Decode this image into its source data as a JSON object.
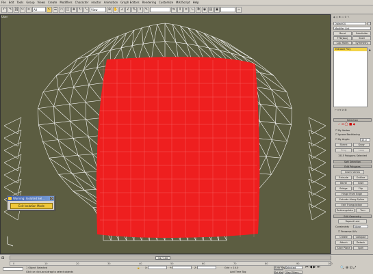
{
  "menu": [
    "File",
    "Edit",
    "Tools",
    "Group",
    "Views",
    "Create",
    "Modifiers",
    "Character",
    "reactor",
    "Animation",
    "Graph Editors",
    "Rendering",
    "Customize",
    "MAXScript",
    "Help"
  ],
  "toolbar": {
    "filter": "All",
    "ref_coord": "View",
    "named_set": ""
  },
  "viewport": {
    "label": "User"
  },
  "panel": {
    "object_name": "Object04",
    "modifier_list": "Modifier List",
    "buttons_row1": [
      "Bend",
      "Subdivide"
    ],
    "buttons_row2": [
      "FFD(box)",
      "Shell"
    ],
    "buttons_row3": [
      "Cap Holes",
      "Symmetry"
    ],
    "stack_item": "Editable Poly",
    "selection_title": "Selection",
    "by_vertex": "By Vertex",
    "ignore_backfacing": "Ignore Backfacing",
    "by_angle": "By Angle:",
    "by_angle_value": "45.0",
    "shrink": "Shrink",
    "grow": "Grow",
    "ring": "Ring",
    "loop": "Loop",
    "selected_info": "1515 Polygons Selected",
    "soft_selection": "Soft Selection",
    "edit_polygons": "Edit Polygons",
    "insert_vertex": "Insert Vertex",
    "extrude": "Extrude",
    "outline": "Outline",
    "bevel": "Bevel",
    "inset": "Inset",
    "bridge": "Bridge",
    "flip": "Flip",
    "hinge": "Hinge From Edge",
    "extrude_spline": "Extrude Along Spline",
    "edit_triangulation": "Edit Triangulation",
    "retriangulate": "Retriangulate",
    "turn": "Turn",
    "edit_geometry": "Edit Geometry",
    "repeat_last": "Repeat Last",
    "constraints": "Constraints",
    "constraints_value": "None",
    "preserve_uvs": "Preserve UVs",
    "create": "Create",
    "collapse": "Collapse",
    "attach": "Attach",
    "detach": "Detach",
    "slice_plane": "Slice Plane",
    "split": "Split",
    "reset_plane": "Reset Plane",
    "quickslice": "QuickSlice",
    "cut": "Cut",
    "msmooth": "MSmooth",
    "tessellate": "Tessellate",
    "make_planar": "Make Planar"
  },
  "dialog": {
    "title": "Warning: Isolated Sel...",
    "button": "Exit Isolation Mode"
  },
  "timeline": {
    "frame": "34 / 100",
    "ticks": [
      "0",
      "10",
      "20",
      "30",
      "40",
      "50",
      "60",
      "70",
      "80",
      "90",
      "100"
    ]
  },
  "status": {
    "objects_selected": "1 Object Selected",
    "prompt": "Click or click-and-drag to select objects",
    "grid": "Grid = 10.0",
    "add_time_tag": "Add Time Tag",
    "auto_key": "Auto Key",
    "selected": "Selected",
    "set_key": "Set Key",
    "key_filters": "Key Filters...",
    "x_label": "X:",
    "y_label": "Y:",
    "z_label": "Z:"
  },
  "colors": {
    "viewport_bg": "#5c5d41",
    "selection_red": "#ee1f1f",
    "wire": "#ffffff"
  }
}
